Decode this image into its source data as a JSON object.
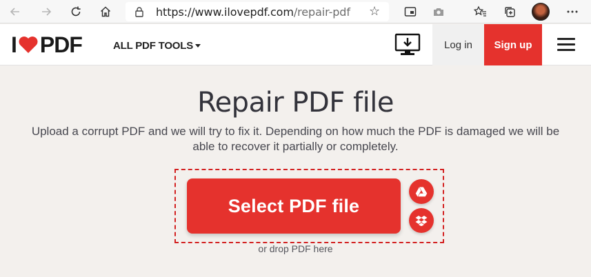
{
  "browser": {
    "url_host": "https://www.ilovepdf.com",
    "url_path": "/repair-pdf",
    "icons": [
      "back-arrow-icon",
      "forward-arrow-icon",
      "refresh-icon",
      "home-icon",
      "lock-icon",
      "star-icon",
      "immersive-reader-icon",
      "camera-icon",
      "favorites-icon",
      "collections-icon",
      "profile-avatar",
      "more-icon"
    ]
  },
  "header": {
    "logo_left": "I",
    "logo_right": "PDF",
    "tools_label": "ALL PDF TOOLS",
    "login_label": "Log in",
    "signup_label": "Sign up"
  },
  "main": {
    "title": "Repair PDF file",
    "subtitle": "Upload a corrupt PDF and we will try to fix it. Depending on how much the PDF is damaged we will be able to recover it partially or completely.",
    "select_label": "Select PDF file",
    "drop_hint": "or drop PDF here"
  },
  "colors": {
    "brand_red": "#e5322d",
    "highlight_dashed": "#d32020",
    "page_bg": "#f3f0ed"
  }
}
